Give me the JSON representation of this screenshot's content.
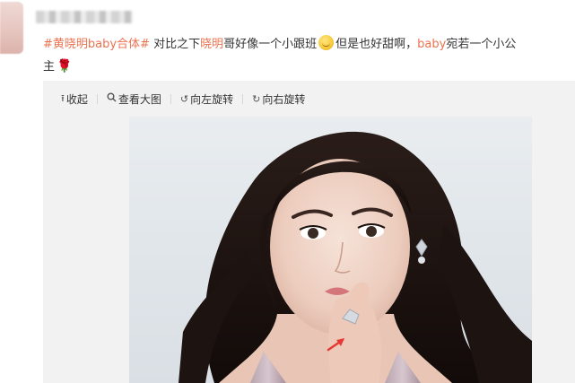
{
  "post": {
    "topic": "#黄晓明baby合体#",
    "text_1": " 对比之下",
    "mention_1": "晓明",
    "text_2": "哥好像一个小跟班",
    "emoji_1": "blush-emoji",
    "text_3": "但是也好甜啊，",
    "mention_2": "baby",
    "text_4": "宛若一个小公",
    "text_5": "主",
    "emoji_2": "rose-emoji"
  },
  "toolbar": {
    "collapse_label": "收起",
    "collapse_icon": "collapse-arrow-icon",
    "view_large_label": "查看大图",
    "view_large_icon": "magnifier-icon",
    "rotate_left_label": "向左旋转",
    "rotate_left_icon": "rotate-left-icon",
    "rotate_right_label": "向右旋转",
    "rotate_right_icon": "rotate-right-icon"
  },
  "photo": {
    "subject": "portrait of woman with long dark hair, hand to lips, red arrow annotation",
    "annotation_color": "#e53935"
  },
  "colors": {
    "link": "#eb7350",
    "text": "#333333",
    "media_bg": "#f2f2f2"
  }
}
